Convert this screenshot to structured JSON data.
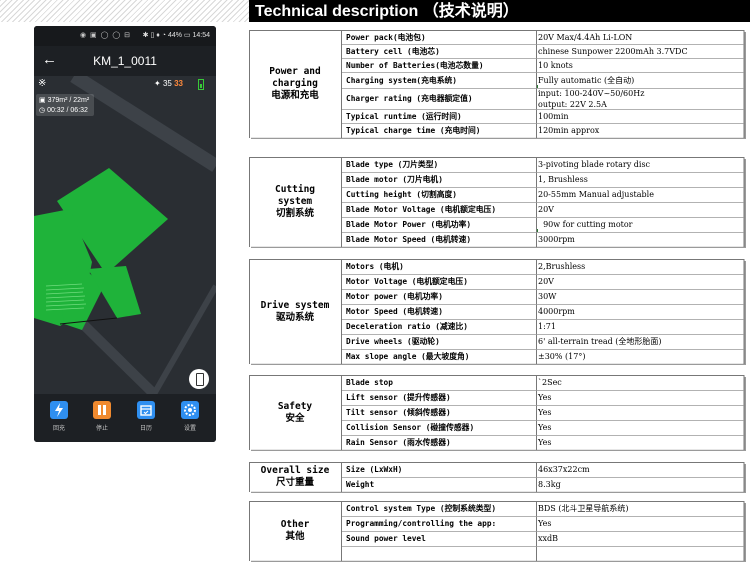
{
  "title": "Technical description （技术说明）",
  "phone": {
    "status_left": "◉ ▣ ◯ ◯ ⊟",
    "status_right": "✱ ▯ ♦ ◔ 44% ▭ 14:54",
    "back_icon": "arrow-left-icon",
    "app_title": "KM_1_0011",
    "signal_value": "35",
    "battery_value": "33",
    "area": "379m² / 22m²",
    "time": "00:32 / 06:32",
    "nav": [
      {
        "label": "回充",
        "icon": "lightning-icon",
        "color": "#2f8ff0"
      },
      {
        "label": "停止",
        "icon": "pause-icon",
        "color": "#f08a2f"
      },
      {
        "label": "日历",
        "icon": "calendar-icon",
        "color": "#2f8ff0"
      },
      {
        "label": "设置",
        "icon": "gear-icon",
        "color": "#2f8ff0"
      }
    ],
    "colors": {
      "mowed": "#1fb33a",
      "background": "#2a2e33",
      "road": "#3a3f45"
    }
  },
  "sections": [
    {
      "label": "Power and charging\n电源和充电",
      "rows": [
        {
          "k": "Power pack(电池包)",
          "v": [
            "20V Max/4.4Ah Li-LON"
          ]
        },
        {
          "k": "Battery cell (电池芯)",
          "v": [
            "chinese Sunpower 2200mAh 3.7VDC"
          ]
        },
        {
          "k": "Number of Batteries(电池芯数量)",
          "v": [
            "10 knots"
          ]
        },
        {
          "k": "Charging system(充电系统)",
          "v": [
            "Fully automatic (全自动)"
          ],
          "tick": true
        },
        {
          "k": "Charger rating (充电器额定值)",
          "v": [
            "input: 100-240V~50/60Hz",
            "output: 22V 2.5A"
          ]
        },
        {
          "k": "Typical runtime (运行时间)",
          "v": [
            "100min"
          ]
        },
        {
          "k": "Typical charge time (充电时间)",
          "v": [
            "120min approx"
          ]
        }
      ]
    },
    {
      "label": "Cutting\nsystem\n切割系统",
      "rows": [
        {
          "k": "Blade type (刀片类型)",
          "v": [
            "3-pivoting blade rotary disc"
          ]
        },
        {
          "k": "Blade motor (刀片电机)",
          "v": [
            "1, Brushless"
          ]
        },
        {
          "k": "Cutting height (切割高度)",
          "v": [
            "20-55mm Manual adjustable"
          ]
        },
        {
          "k": "Blade Motor Voltage (电机额定电压)",
          "v": [
            "20V"
          ]
        },
        {
          "k": "Blade Motor Power (电机功率)",
          "v": [
            "  90w for cutting motor"
          ],
          "tick": true
        },
        {
          "k": "Blade Motor Speed (电机转速)",
          "v": [
            "3000rpm"
          ]
        }
      ]
    },
    {
      "label": "Drive system\n驱动系统",
      "rows": [
        {
          "k": "Motors (电机)",
          "v": [
            "2,Brushless"
          ]
        },
        {
          "k": "Motor Voltage (电机额定电压)",
          "v": [
            "20V"
          ]
        },
        {
          "k": "Motor power (电机功率)",
          "v": [
            "30W"
          ]
        },
        {
          "k": "Motor Speed (电机转速)",
          "v": [
            "4000rpm"
          ]
        },
        {
          "k": "Deceleration ratio (减速比)",
          "v": [
            "1:71"
          ]
        },
        {
          "k": "Drive wheels (驱动轮)",
          "v": [
            "6' all-terrain tread (全地形胎面)"
          ]
        },
        {
          "k": "Max slope angle (最大坡度角)",
          "v": [
            "±30% (17°)"
          ]
        }
      ]
    },
    {
      "label": "Safety\n安全",
      "rows": [
        {
          "k": "Blade stop",
          "v": [
            "`2Sec"
          ]
        },
        {
          "k": "Lift sensor (提升传感器)",
          "v": [
            "Yes"
          ]
        },
        {
          "k": "Tilt sensor (倾斜传感器)",
          "v": [
            "Yes"
          ]
        },
        {
          "k": "Collision Sensor (碰撞传感器)",
          "v": [
            "Yes"
          ]
        },
        {
          "k": "Rain Sensor (雨水传感器)",
          "v": [
            "Yes"
          ]
        }
      ]
    },
    {
      "label": "Overall size\n尺寸重量",
      "rows": [
        {
          "k": "Size (LxWxH)",
          "v": [
            "46x37x22cm"
          ]
        },
        {
          "k": "Weight",
          "v": [
            "8.3kg"
          ]
        }
      ]
    },
    {
      "label": "Other\n其他",
      "rows": [
        {
          "k": "Control system Type (控制系统类型)",
          "v": [
            "BDS (北斗卫星导航系统)"
          ]
        },
        {
          "k": "Programming/controlling the app:",
          "v": [
            "Yes"
          ]
        },
        {
          "k": "Sound power level",
          "v": [
            "xxdB"
          ]
        },
        {
          "k": "",
          "v": [
            ""
          ]
        }
      ]
    }
  ]
}
